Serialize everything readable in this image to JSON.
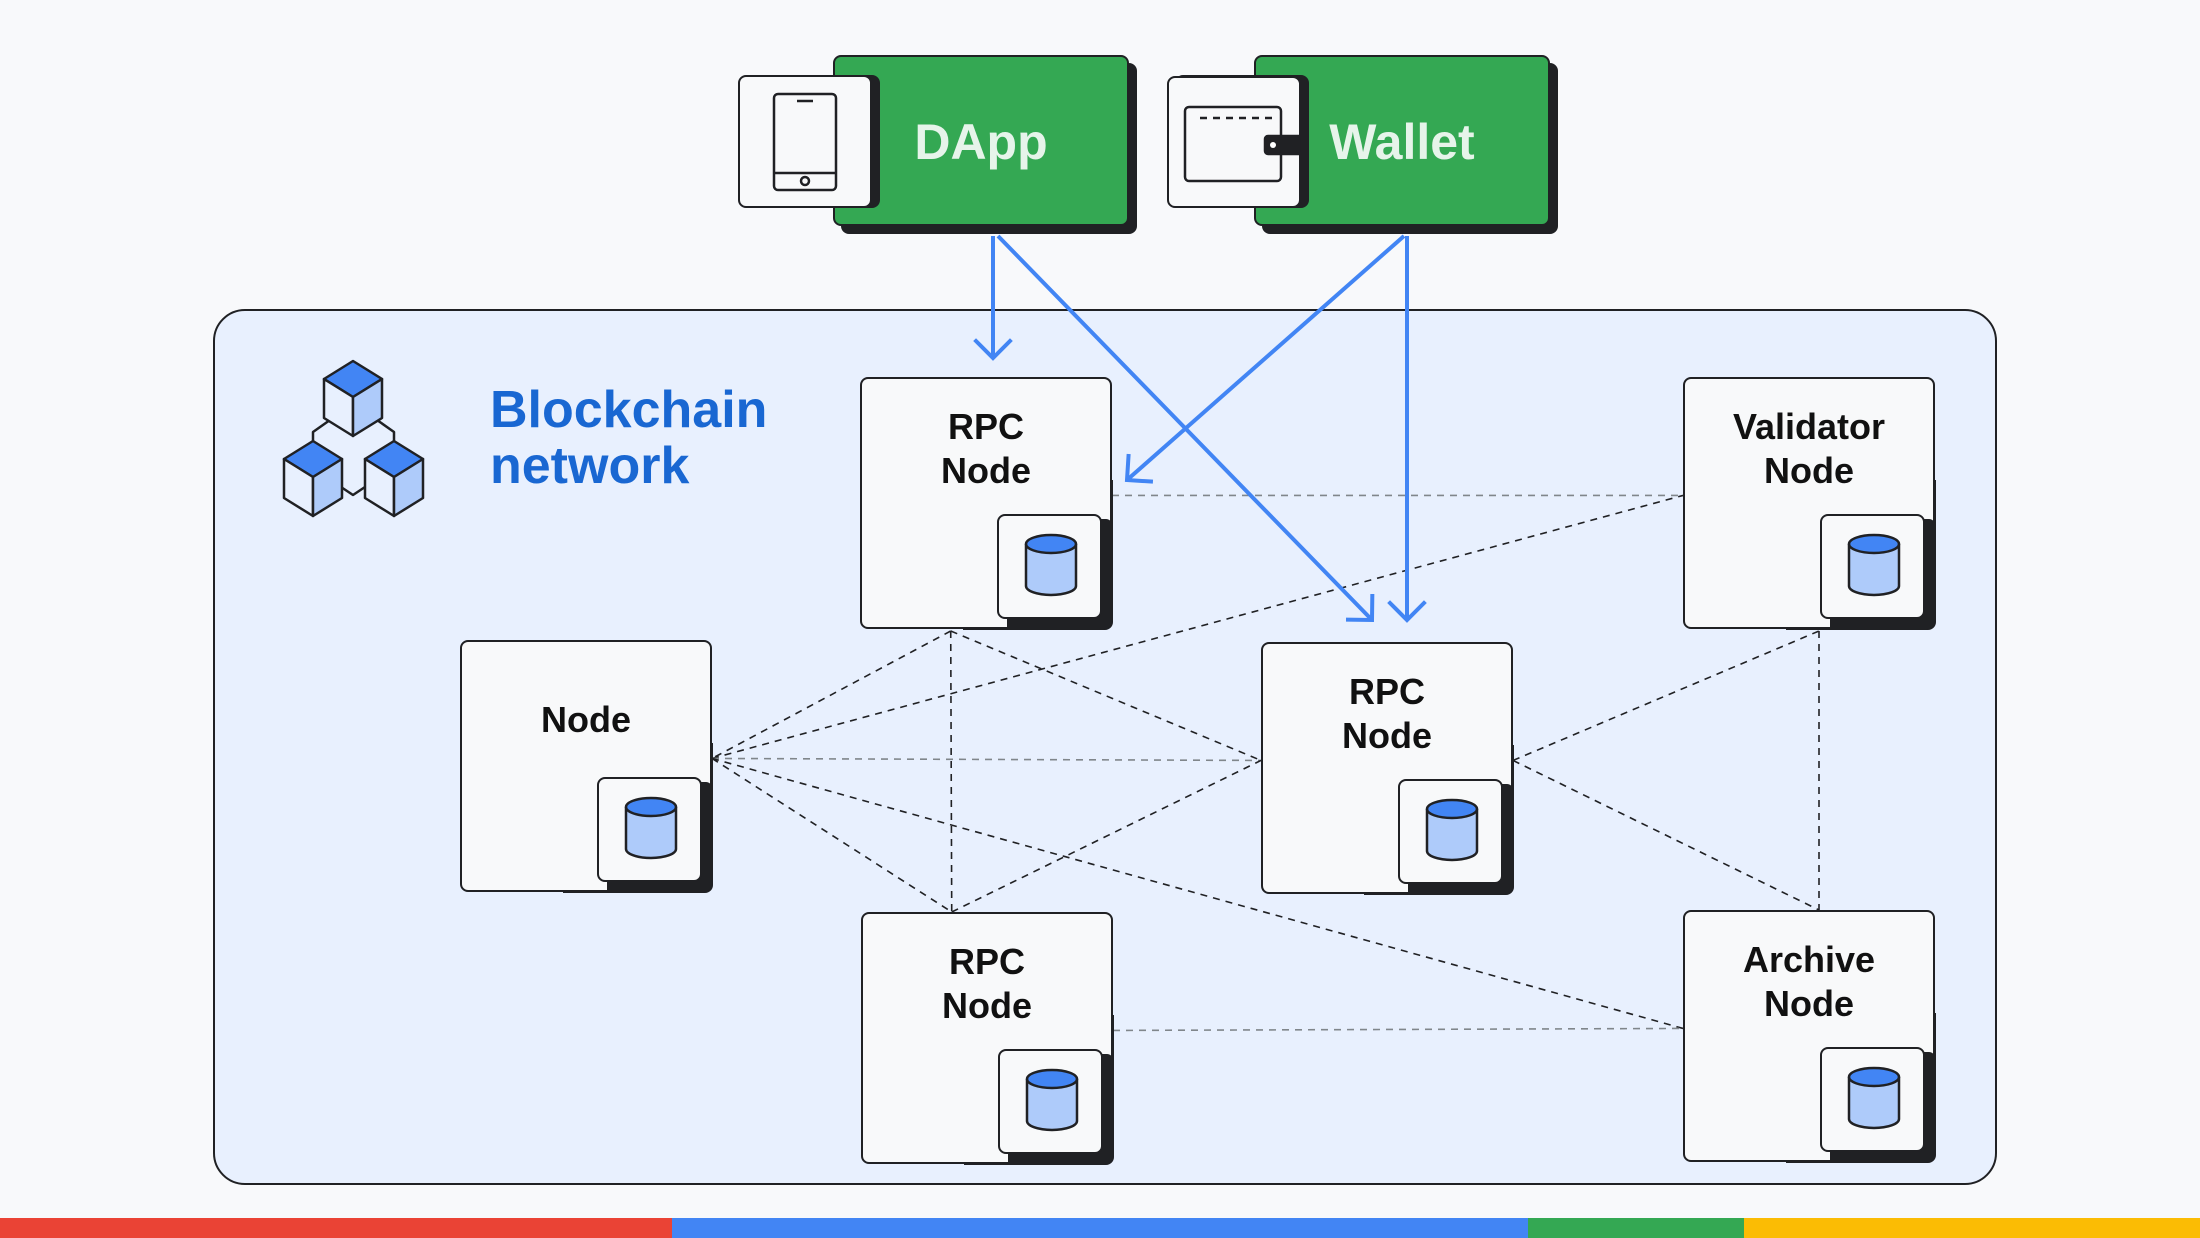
{
  "clients": [
    {
      "id": "dapp",
      "label": "DApp",
      "icon": "smartphone-icon"
    },
    {
      "id": "wallet",
      "label": "Wallet",
      "icon": "wallet-icon"
    }
  ],
  "network": {
    "title_line1": "Blockchain",
    "title_line2": "network",
    "icon": "blockchain-cubes-icon"
  },
  "nodes": [
    {
      "id": "rpc1",
      "line1": "RPC",
      "line2": "Node",
      "icon": "database-icon"
    },
    {
      "id": "validator",
      "line1": "Validator",
      "line2": "Node",
      "icon": "database-icon"
    },
    {
      "id": "node",
      "line1": "Node",
      "line2": "",
      "icon": "database-icon"
    },
    {
      "id": "rpc2",
      "line1": "RPC",
      "line2": "Node",
      "icon": "database-icon"
    },
    {
      "id": "rpc3",
      "line1": "RPC",
      "line2": "Node",
      "icon": "database-icon"
    },
    {
      "id": "archive",
      "line1": "Archive",
      "line2": "Node",
      "icon": "database-icon"
    }
  ],
  "request_arrows": [
    {
      "from": "dapp",
      "to": "rpc1"
    },
    {
      "from": "dapp",
      "to": "rpc2"
    },
    {
      "from": "wallet",
      "to": "rpc1"
    },
    {
      "from": "wallet",
      "to": "rpc2"
    }
  ],
  "peer_links": [
    {
      "from": "rpc1",
      "to": "validator"
    },
    {
      "from": "rpc1",
      "to": "node"
    },
    {
      "from": "rpc1",
      "to": "rpc2"
    },
    {
      "from": "rpc1",
      "to": "rpc3"
    },
    {
      "from": "node",
      "to": "validator"
    },
    {
      "from": "node",
      "to": "rpc2"
    },
    {
      "from": "node",
      "to": "rpc3"
    },
    {
      "from": "node",
      "to": "archive"
    },
    {
      "from": "rpc3",
      "to": "rpc2"
    },
    {
      "from": "rpc3",
      "to": "archive"
    },
    {
      "from": "rpc2",
      "to": "validator"
    },
    {
      "from": "rpc2",
      "to": "archive"
    },
    {
      "from": "validator",
      "to": "archive"
    }
  ],
  "colors": {
    "green": "#34a853",
    "blue_arrow": "#4285f4",
    "title_blue": "#1967d2",
    "network_bg": "#e8f0fe",
    "footer": [
      "#ea4335",
      "#4285f4",
      "#34a853",
      "#fbbc04"
    ]
  }
}
